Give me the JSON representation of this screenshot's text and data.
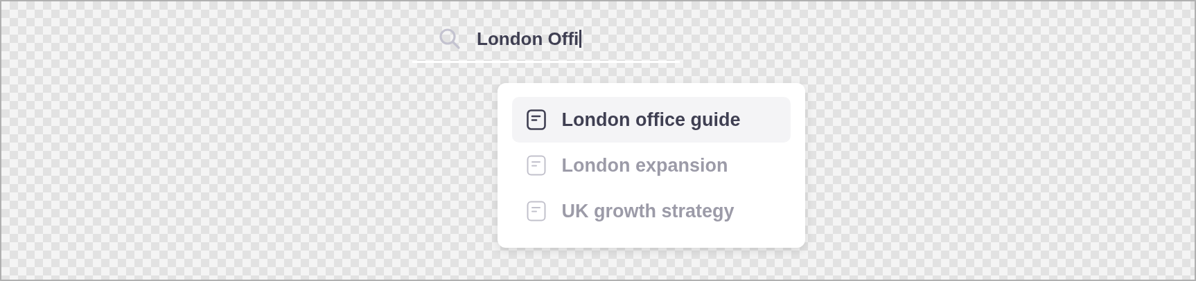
{
  "search": {
    "value": "London Offi",
    "focused": true
  },
  "results": [
    {
      "label": "London office guide",
      "selected": true
    },
    {
      "label": "London expansion",
      "selected": false
    },
    {
      "label": "UK growth strategy",
      "selected": false
    }
  ]
}
